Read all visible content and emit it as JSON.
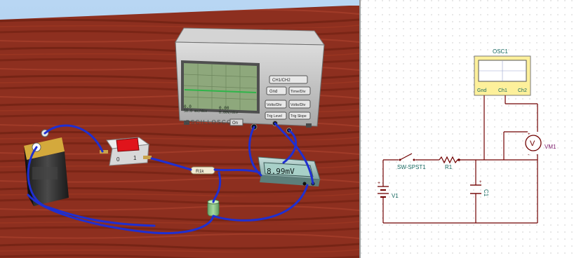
{
  "scene3d": {
    "oscilloscope": {
      "brand": "OSCILLOSCOPE",
      "readout_left_1": "0.0",
      "readout_left_2": "50.0 ms/div",
      "readout_right_1": "0.00",
      "readout_right_2": "0.00V/div",
      "buttons": [
        "CH1/CH2",
        "Gnd",
        "Time/Div",
        "Volts/Div",
        "Volts/Div",
        "Trig Level",
        "Trig Slope",
        "Trig Src"
      ],
      "on_label": "On"
    },
    "meter_display": "8.99mV",
    "resistor_label": "R1k",
    "switch_marks": [
      "0",
      "1"
    ]
  },
  "schematic": {
    "osc_label": "OSC1",
    "osc_ports": [
      "Gnd",
      "Ch1",
      "Ch2"
    ],
    "switch_label": "SW-SPST1",
    "resistor_label": "R1",
    "battery_label": "V1",
    "capacitor_label": "C1",
    "voltmeter_symbol": "V",
    "voltmeter_label": "VM1",
    "plus_sign": "+",
    "minus_sign": "-"
  },
  "colors": {
    "sky": "#aecdee",
    "wood": "#8d2f1f",
    "wire": "#1f2fd1",
    "scope_body": "#c9c9c9",
    "scope_screen": "#8ea87c",
    "trace": "#2fb54a",
    "wire_schematic": "#700000",
    "text_schematic": "#14675f",
    "osc_frame": "#fdf09b"
  }
}
